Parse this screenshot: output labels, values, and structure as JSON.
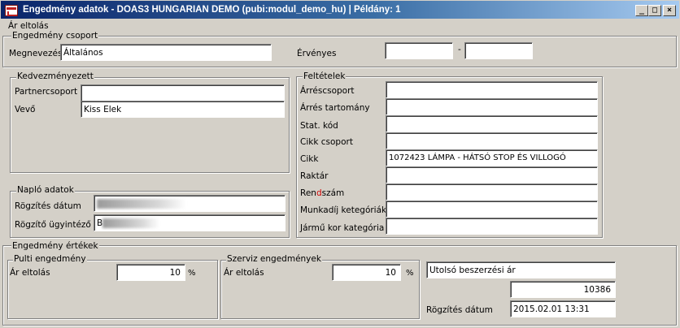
{
  "window": {
    "title": "Engedmény adatok - DOAS3 HUNGARIAN DEMO (pubi:modul_demo_hu) | Példány: 1",
    "controls": {
      "minimize": "_",
      "maximize": "□",
      "close": "×"
    }
  },
  "top_label": "Ár eltolás",
  "csoport": {
    "title": "Engedmény csoport",
    "megnevezes_label": "Megnevezés",
    "megnevezes_value": "Általános",
    "ervenyes_label": "Érvényes",
    "ervenyes_from": "",
    "dash": "-",
    "ervenyes_to": ""
  },
  "kedvezmenyezett": {
    "title": "Kedvezményezett",
    "partnercsoport_label": "Partnercsoport",
    "partnercsoport_value": "",
    "vevo_label": "Vevő",
    "vevo_value": "Kiss Elek"
  },
  "naplo": {
    "title": "Napló adatok",
    "rogzites_datum_label": "Rögzítés dátum",
    "rogzito_label": "Rögzítő ügyintéző",
    "rogzito_initial": "B"
  },
  "feltetelek": {
    "title": "Feltételek",
    "rows": [
      {
        "label": "Árréscsoport",
        "value": ""
      },
      {
        "label": "Árrés tartomány",
        "value": ""
      },
      {
        "label": "Stat. kód",
        "value": ""
      },
      {
        "label": "Cikk csoport",
        "value": ""
      },
      {
        "label": "Cikk",
        "value": "1072423 LÁMPA - HÁTSÓ STOP ÉS VILLOGÓ"
      },
      {
        "label": "Raktár",
        "value": ""
      },
      {
        "label_pre": "Ren",
        "label_red": "d",
        "label_post": "szám",
        "value": ""
      },
      {
        "label": "Munkadíj ketegóriák",
        "value": ""
      },
      {
        "label": "Jármű kor kategória",
        "value": ""
      }
    ],
    "label_red_color": "#d00000"
  },
  "ertekek": {
    "title": "Engedmény értékek",
    "pulti": {
      "title": "Pulti engedmény",
      "label": "Ár eltolás",
      "value": "10",
      "unit": "%"
    },
    "szerviz": {
      "title": "Szerviz  engedmények",
      "label": "Ár eltolás",
      "value": "10",
      "unit": "%"
    },
    "beszerzes_label": "Utolsó beszerzési ár",
    "beszerzes_value": "10386",
    "rogzites_label": "Rögzítés dátum",
    "rogzites_value": "2015.02.01 13:31"
  },
  "colors": {
    "titlebar_start": "#0a246a",
    "titlebar_end": "#a6caf0",
    "face": "#d4d0c8"
  }
}
